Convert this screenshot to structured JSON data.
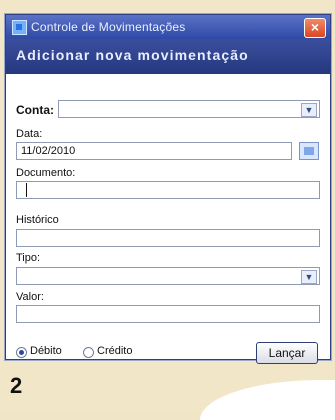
{
  "window": {
    "title": "Controle de Movimentações",
    "header": "Adicionar nova movimentação"
  },
  "form": {
    "conta": {
      "label": "Conta:",
      "value": ""
    },
    "data": {
      "label": "Data:",
      "value": "11/02/2010"
    },
    "documento": {
      "label": "Documento:",
      "value": ""
    },
    "historico": {
      "label": "Histórico",
      "value": ""
    },
    "tipo": {
      "label": "Tipo:",
      "value": ""
    },
    "valor": {
      "label": "Valor:",
      "value": ""
    },
    "radio_options": [
      {
        "label": "Débito",
        "checked": true
      },
      {
        "label": "Crédito",
        "checked": false
      }
    ],
    "submit_label": "Lançar"
  },
  "page_number": "2",
  "icons": {
    "app": "app-icon",
    "close": "close-icon",
    "calendar": "calendar-icon",
    "dropdown": "chevron-down-icon"
  },
  "colors": {
    "titlebar": "#2e4aa6",
    "header": "#24387f",
    "page_bg": "#f1e6c8"
  }
}
